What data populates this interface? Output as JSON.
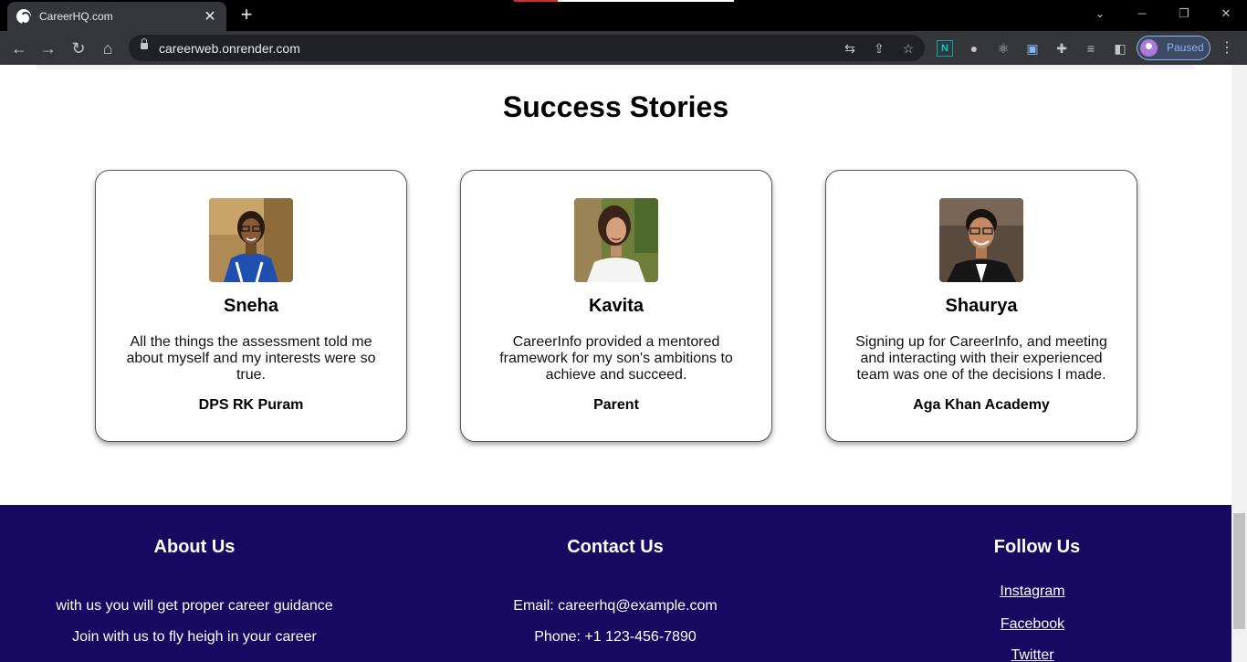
{
  "browser": {
    "tab_title": "CareerHQ.com",
    "url": "careerweb.onrender.com",
    "profile_status": "Paused",
    "window_controls": [
      "chevron-down-icon",
      "minimize-icon",
      "restore-icon",
      "close-icon"
    ]
  },
  "page": {
    "section_title": "Success Stories",
    "stories": [
      {
        "name": "Sneha",
        "quote": "All the things the assessment told me about myself and my interests were so true.",
        "org": "DPS RK Puram"
      },
      {
        "name": "Kavita",
        "quote": "CareerInfo provided a mentored framework for my son's ambitions to achieve and succeed.",
        "org": "Parent"
      },
      {
        "name": "Shaurya",
        "quote": "Signing up for CareerInfo, and meeting and interacting with their experienced team was one of the decisions I made.",
        "org": "Aga Khan Academy"
      }
    ]
  },
  "footer": {
    "about": {
      "title": "About Us",
      "lines": [
        "with us you will get proper career guidance",
        "Join with us to fly heigh in your career"
      ]
    },
    "contact": {
      "title": "Contact Us",
      "email": "Email: careerhq@example.com",
      "phone": "Phone: +1 123-456-7890"
    },
    "follow": {
      "title": "Follow Us",
      "links": [
        "Instagram",
        "Facebook",
        "Twitter"
      ]
    },
    "colors": {
      "background": "#170862",
      "text": "#ffffff"
    }
  }
}
